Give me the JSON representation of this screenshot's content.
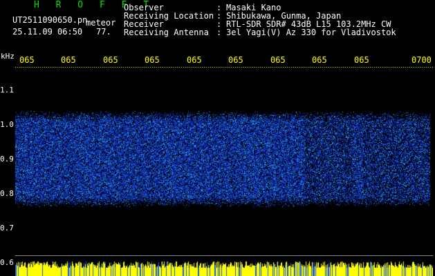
{
  "app": {
    "title": "H R O F F T",
    "filename": "UT2511090650.pn",
    "label": "meteor",
    "datetime": "25.11.09 06:50",
    "gain_value": "77."
  },
  "station": {
    "rows": [
      {
        "label": "Observer",
        "sep": ":",
        "value": "Masaki Kano"
      },
      {
        "label": "Receiving Location",
        "sep": ":",
        "value": "Shibukawa, Gunma, Japan"
      },
      {
        "label": "Receiver",
        "sep": ":",
        "value": "RTL-SDR SDR# 43dB L15 103.2MHz CW"
      },
      {
        "label": "Receiving Antenna",
        "sep": ":",
        "value": "3el Yagi(V) Az 330 for Vladivostok"
      }
    ]
  },
  "axes": {
    "y_unit": "kHz",
    "y_labels": [
      "1.1",
      "1.0",
      "0.9",
      "0.8",
      "0.7",
      "0.6"
    ],
    "time_labels": [
      "065",
      "065",
      "065",
      "065",
      "065",
      "065",
      "065",
      "065",
      "065",
      "0700"
    ]
  },
  "colors": {
    "background": "#000000",
    "header_text": "#ffffff",
    "app_title": "#00e000",
    "time_labels": "#ffff00",
    "signal_low": "#0a1e8c",
    "signal_mid": "#1e5adc",
    "signal_high": "#28c8c8",
    "footer_strip": "#ffff00"
  }
}
